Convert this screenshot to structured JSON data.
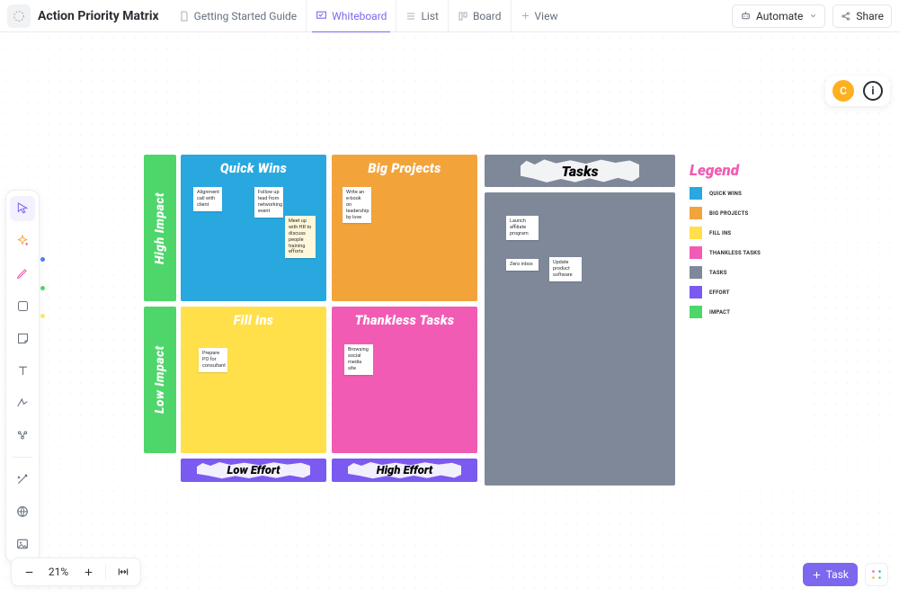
{
  "header": {
    "title": "Action Priority Matrix",
    "views": [
      {
        "label": "Getting Started Guide"
      },
      {
        "label": "Whiteboard"
      },
      {
        "label": "List"
      },
      {
        "label": "Board"
      },
      {
        "label": "View"
      }
    ],
    "automate_label": "Automate",
    "share_label": "Share",
    "avatar_initial": "C"
  },
  "zoom": {
    "percent": "21%"
  },
  "task_button_label": "Task",
  "whiteboard": {
    "y_labels": [
      "High Impact",
      "Low Impact"
    ],
    "x_labels": [
      "Low Effort",
      "High Effort"
    ],
    "tasks_title": "Tasks",
    "quadrants": {
      "quick_wins": {
        "title": "Quick Wins",
        "cards": [
          {
            "text": "Alignment call with client"
          },
          {
            "text": "Follow up lead from networking event"
          },
          {
            "text": "Meet up with HR to discuss people training efforts"
          }
        ]
      },
      "big_projects": {
        "title": "Big Projects",
        "cards": [
          {
            "text": "Write an e-book on leadership by love"
          }
        ]
      },
      "fill_ins": {
        "title": "Fill Ins",
        "cards": [
          {
            "text": "Prepare PO for consultant"
          }
        ]
      },
      "thankless": {
        "title": "Thankless Tasks",
        "cards": [
          {
            "text": "Browsing social media site"
          }
        ]
      }
    },
    "task_cards": [
      {
        "text": "Launch affiliate program"
      },
      {
        "text": "Zero inbox"
      },
      {
        "text": "Update product software"
      }
    ]
  },
  "legend": {
    "title": "Legend",
    "items": [
      {
        "label": "QUICK WINS",
        "color": "#29a8df"
      },
      {
        "label": "BIG PROJECTS",
        "color": "#f2a43b"
      },
      {
        "label": "FILL INS",
        "color": "#ffe04a"
      },
      {
        "label": "THANKLESS TASKS",
        "color": "#f25bb4"
      },
      {
        "label": "TASKS",
        "color": "#7f8899"
      },
      {
        "label": "EFFORT",
        "color": "#7a5af0"
      },
      {
        "label": "IMPACT",
        "color": "#4ed66b"
      }
    ]
  }
}
